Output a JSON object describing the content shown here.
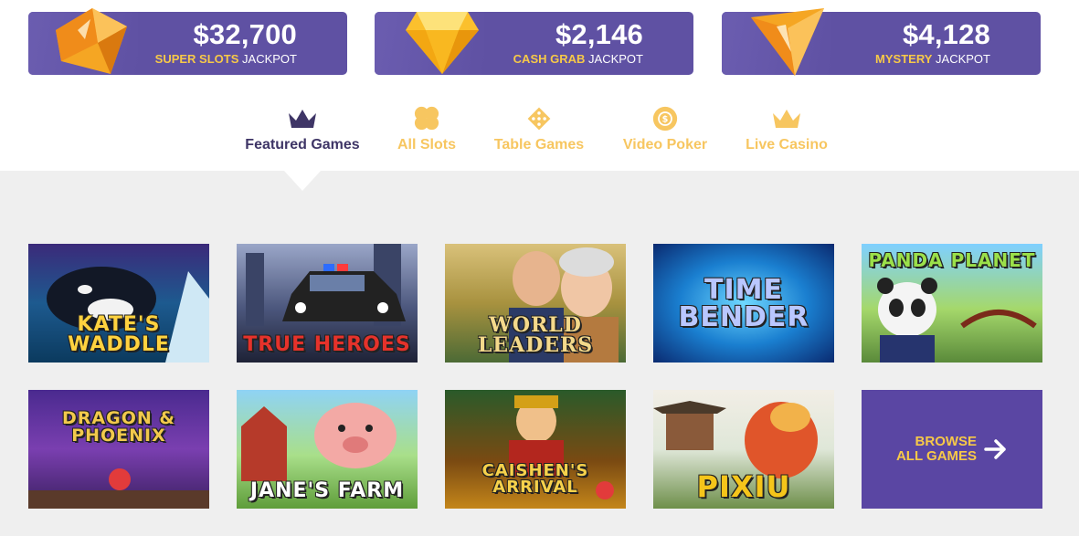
{
  "jackpots": [
    {
      "amount": "$32,700",
      "name": "SUPER SLOTS",
      "suffix": "JACKPOT",
      "gem": "orange-diamond-icon"
    },
    {
      "amount": "$2,146",
      "name": "CASH GRAB",
      "suffix": "JACKPOT",
      "gem": "yellow-diamond-icon"
    },
    {
      "amount": "$4,128",
      "name": "MYSTERY",
      "suffix": "JACKPOT",
      "gem": "triangle-gem-icon"
    }
  ],
  "tabs": [
    {
      "label": "Featured Games",
      "icon": "crown-icon",
      "active": true
    },
    {
      "label": "All Slots",
      "icon": "clover-icon",
      "active": false
    },
    {
      "label": "Table Games",
      "icon": "dice-icon",
      "active": false
    },
    {
      "label": "Video Poker",
      "icon": "chip-icon",
      "active": false
    },
    {
      "label": "Live Casino",
      "icon": "crown-icon",
      "active": false
    }
  ],
  "games": [
    {
      "title": "KATE'S WADDLE"
    },
    {
      "title": "TRUE HEROES"
    },
    {
      "title": "WORLD LEADERS"
    },
    {
      "title": "TIME BENDER"
    },
    {
      "title": "PANDA PLANET"
    },
    {
      "title": "DRAGON & PHOENIX"
    },
    {
      "title": "JANE'S FARM"
    },
    {
      "title": "CAISHEN'S ARRIVAL"
    },
    {
      "title": "PIXIU"
    }
  ],
  "browse": {
    "line1": "BROWSE",
    "line2": "ALL GAMES"
  },
  "colors": {
    "purple": "#5f51a3",
    "gold": "#f7c948",
    "active_tab": "#3e3566",
    "bg": "#efefef"
  }
}
